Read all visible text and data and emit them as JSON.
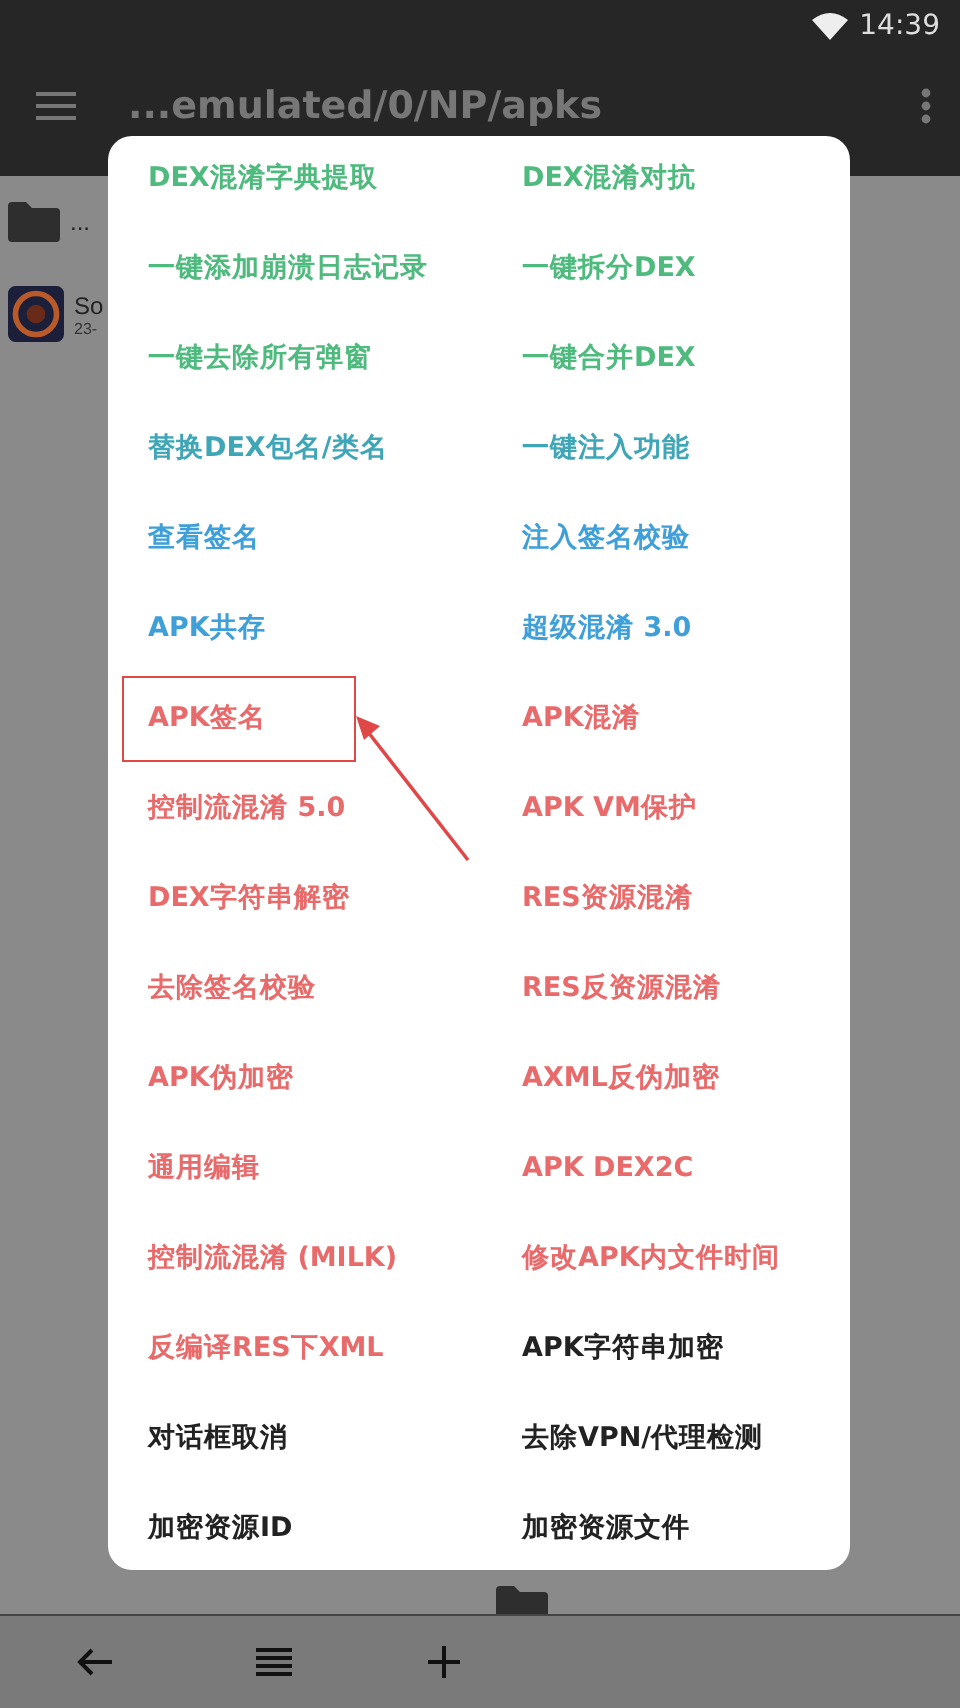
{
  "status_bar": {
    "time": "14:39"
  },
  "toolbar": {
    "title": "...emulated/0/NP/apks"
  },
  "file_list": [
    {
      "kind": "folder",
      "name": "..."
    },
    {
      "kind": "app",
      "name": "So",
      "detail": "23-"
    },
    {
      "kind": "folder"
    }
  ],
  "menu": {
    "items": [
      {
        "label": "DEX混淆字典提取",
        "color": "#4fba7e",
        "highlighted": false
      },
      {
        "label": "DEX混淆对抗",
        "color": "#4fba7e",
        "highlighted": false
      },
      {
        "label": "一键添加崩溃日志记录",
        "color": "#4fba7e",
        "highlighted": false
      },
      {
        "label": "一键拆分DEX",
        "color": "#4fba7e",
        "highlighted": false
      },
      {
        "label": "一键去除所有弹窗",
        "color": "#4fba7e",
        "highlighted": false
      },
      {
        "label": "一键合并DEX",
        "color": "#4fba7e",
        "highlighted": false
      },
      {
        "label": "替换DEX包名/类名",
        "color": "#3fa6b8",
        "highlighted": false
      },
      {
        "label": "一键注入功能",
        "color": "#3fa6b8",
        "highlighted": false
      },
      {
        "label": "查看签名",
        "color": "#3f9fd8",
        "highlighted": false
      },
      {
        "label": "注入签名校验",
        "color": "#3f9fd8",
        "highlighted": false
      },
      {
        "label": "APK共存",
        "color": "#3f9fd8",
        "highlighted": false
      },
      {
        "label": "超级混淆 3.0",
        "color": "#3f9fd8",
        "highlighted": false
      },
      {
        "label": "APK签名",
        "color": "#e86a6a",
        "highlighted": true
      },
      {
        "label": "APK混淆",
        "color": "#e86a6a",
        "highlighted": false
      },
      {
        "label": "控制流混淆 5.0",
        "color": "#e86a6a",
        "highlighted": false
      },
      {
        "label": "APK VM保护",
        "color": "#e86a6a",
        "highlighted": false
      },
      {
        "label": "DEX字符串解密",
        "color": "#e86a6a",
        "highlighted": false
      },
      {
        "label": "RES资源混淆",
        "color": "#e86a6a",
        "highlighted": false
      },
      {
        "label": "去除签名校验",
        "color": "#e86a6a",
        "highlighted": false
      },
      {
        "label": "RES反资源混淆",
        "color": "#e86a6a",
        "highlighted": false
      },
      {
        "label": "APK伪加密",
        "color": "#e86a6a",
        "highlighted": false
      },
      {
        "label": "AXML反伪加密",
        "color": "#e86a6a",
        "highlighted": false
      },
      {
        "label": "通用编辑",
        "color": "#e86a6a",
        "highlighted": false
      },
      {
        "label": "APK DEX2C",
        "color": "#e86a6a",
        "highlighted": false
      },
      {
        "label": "控制流混淆 (MILK)",
        "color": "#e86a6a",
        "highlighted": false
      },
      {
        "label": "修改APK内文件时间",
        "color": "#e86a6a",
        "highlighted": false
      },
      {
        "label": "反编译RES下XML",
        "color": "#e86a6a",
        "highlighted": false
      },
      {
        "label": "APK字符串加密",
        "color": "#222222",
        "highlighted": false
      },
      {
        "label": "对话框取消",
        "color": "#222222",
        "highlighted": false
      },
      {
        "label": "去除VPN/代理检测",
        "color": "#222222",
        "highlighted": false
      },
      {
        "label": "加密资源ID",
        "color": "#222222",
        "highlighted": false
      },
      {
        "label": "加密资源文件",
        "color": "#222222",
        "highlighted": false
      }
    ]
  }
}
